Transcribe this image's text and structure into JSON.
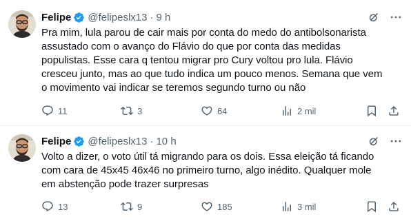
{
  "colors": {
    "text": "#0f1419",
    "muted": "#536471",
    "verified": "#1d9bf0",
    "divider": "#eff3f4"
  },
  "tweets": [
    {
      "author_name": "Felipe",
      "handle": "@felipeslx13",
      "separator": "·",
      "time": "9 h",
      "text": "Pra mim, lula parou de cair mais por conta do medo do antibolsonarista\nassustado com o avanço do Flávio do que por conta das medidas\npopulistas. Esse cara q tentou migrar pro Cury voltou pro lula. Flávio\ncresceu junto, mas ao que tudo indica um pouco menos. Semana que vem\no movimento vai indicar se teremos segundo turno ou não",
      "replies": "11",
      "reposts": "3",
      "likes": "64",
      "views": "2 mil"
    },
    {
      "author_name": "Felipe",
      "handle": "@felipeslx13",
      "separator": "·",
      "time": "10 h",
      "text": "Volto a dizer, o voto útil tá migrando para os dois. Essa eleição tá ficando\ncom cara de 45x45 46x46 no primeiro turno, algo inédito. Qualquer mole\nem abstenção pode trazer surpresas",
      "replies": "13",
      "reposts": "9",
      "likes": "185",
      "views": "3 mil"
    }
  ]
}
